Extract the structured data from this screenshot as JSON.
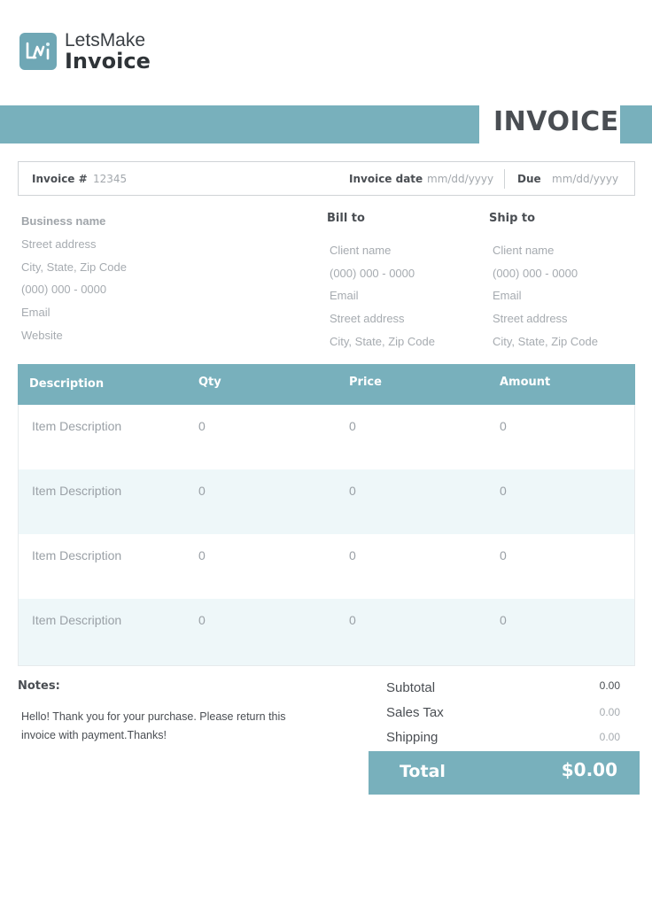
{
  "brand": {
    "line1": "LetsMake",
    "line2": "Invoice",
    "icon": "lmi-logo-icon",
    "color": "#6fa7b5"
  },
  "title": "INVOICE",
  "accent_color": "#78b0bc",
  "meta": {
    "invoice_label": "Invoice #",
    "invoice_value": "12345",
    "date_label": "Invoice date",
    "date_value": "mm/dd/yyyy",
    "due_label": "Due",
    "due_value": "mm/dd/yyyy"
  },
  "business": {
    "name": "Business name",
    "street": "Street address",
    "city": "City, State, Zip Code",
    "phone": "(000) 000 - 0000",
    "email": "Email",
    "website": "Website"
  },
  "bill_to": {
    "heading": "Bill to",
    "name": "Client name",
    "phone": "(000) 000 - 0000",
    "email": "Email",
    "street": "Street address",
    "city": "City, State, Zip Code"
  },
  "ship_to": {
    "heading": "Ship to",
    "name": "Client name",
    "phone": "(000) 000 - 0000",
    "email": "Email",
    "street": "Street address",
    "city": "City, State, Zip Code"
  },
  "table": {
    "headers": [
      "Description",
      "Qty",
      "Price",
      "Amount"
    ],
    "rows": [
      [
        "Item Description",
        "0",
        "0",
        "0"
      ],
      [
        "Item Description",
        "0",
        "0",
        "0"
      ],
      [
        "Item Description",
        "0",
        "0",
        "0"
      ],
      [
        "Item Description",
        "0",
        "0",
        "0"
      ]
    ]
  },
  "notes": {
    "heading": "Notes:",
    "text": "Hello! Thank you for your purchase. Please return this invoice with payment.Thanks!"
  },
  "summary": {
    "subtotal_label": "Subtotal",
    "subtotal_value": "0.00",
    "tax_label": "Sales Tax",
    "tax_value": "0.00",
    "shipping_label": "Shipping",
    "shipping_value": "0.00",
    "total_label": "Total",
    "total_value": "$0.00"
  }
}
